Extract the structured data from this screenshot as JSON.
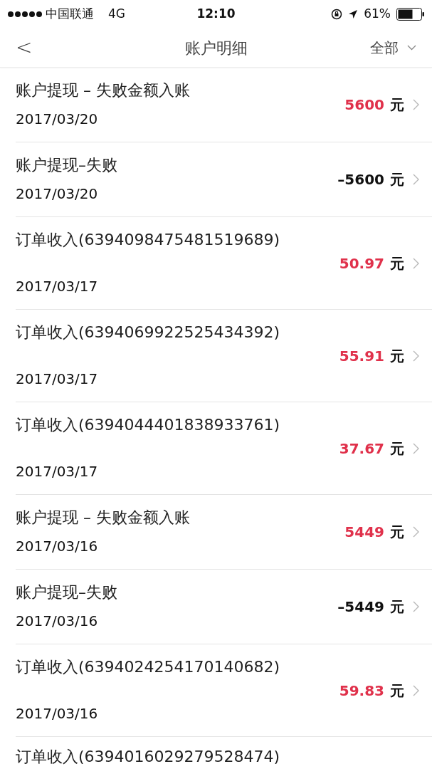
{
  "status_bar": {
    "carrier": "中国联通",
    "network": "4G",
    "time": "12:10",
    "battery": "61%"
  },
  "nav": {
    "back": "<",
    "title": "账户明细",
    "filter": "全部"
  },
  "rows": [
    {
      "kind": "compact",
      "title": "账户提现 – 失败金额入账",
      "date": "2017/03/20",
      "amount": "5600",
      "negative": false,
      "unit": "元"
    },
    {
      "kind": "compact",
      "title": "账户提现–失败",
      "date": "2017/03/20",
      "amount": "–5600",
      "negative": true,
      "unit": "元"
    },
    {
      "kind": "tall",
      "title": "订单收入(6394098475481519689)",
      "date": "2017/03/17",
      "amount": "50.97",
      "negative": false,
      "unit": "元"
    },
    {
      "kind": "tall",
      "title": "订单收入(6394069922525434392)",
      "date": "2017/03/17",
      "amount": "55.91",
      "negative": false,
      "unit": "元"
    },
    {
      "kind": "tall",
      "title": "订单收入(6394044401838933761)",
      "date": "2017/03/17",
      "amount": "37.67",
      "negative": false,
      "unit": "元"
    },
    {
      "kind": "compact",
      "title": "账户提现 – 失败金额入账",
      "date": "2017/03/16",
      "amount": "5449",
      "negative": false,
      "unit": "元"
    },
    {
      "kind": "compact",
      "title": "账户提现–失败",
      "date": "2017/03/16",
      "amount": "–5449",
      "negative": true,
      "unit": "元"
    },
    {
      "kind": "tall",
      "title": "订单收入(6394024254170140682)",
      "date": "2017/03/16",
      "amount": "59.83",
      "negative": false,
      "unit": "元"
    },
    {
      "kind": "cut",
      "title": "订单收入(6394016029279528474)"
    }
  ]
}
